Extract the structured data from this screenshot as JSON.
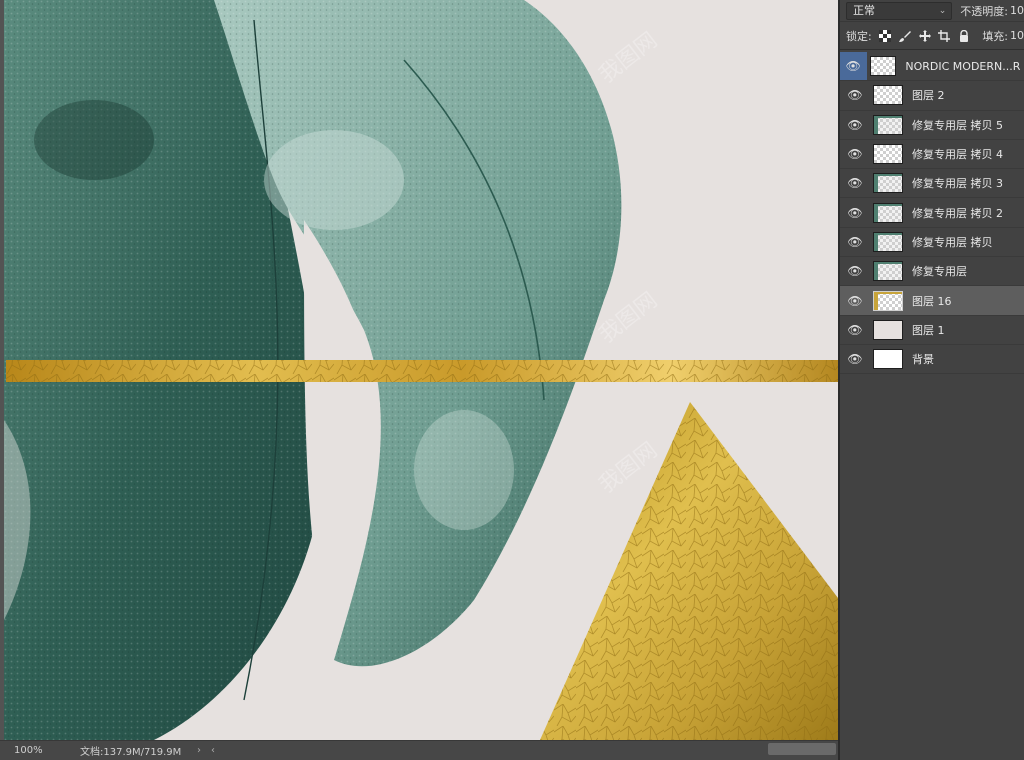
{
  "statusbar": {
    "zoom": "100%",
    "doc_info": "文档:137.9M/719.9M",
    "nav_right": "›",
    "nav_left": "‹"
  },
  "panel": {
    "blend_mode": "正常",
    "opacity_label": "不透明度:",
    "opacity_value": "10",
    "lock_label": "锁定:",
    "fill_label": "填充:",
    "fill_value": "10",
    "lock_icons": [
      "checkerboard-lock-icon",
      "brush-lock-icon",
      "move-lock-icon",
      "artboard-lock-icon",
      "padlock-icon"
    ]
  },
  "layers": [
    {
      "name": "NORDIC MODERN...R DE",
      "thumb": "checker",
      "visible": true
    },
    {
      "name": "图层 2",
      "thumb": "checker",
      "visible": true
    },
    {
      "name": "修复专用层 拷贝 5",
      "thumb": "leafy",
      "visible": true
    },
    {
      "name": "修复专用层 拷贝 4",
      "thumb": "checker",
      "visible": true
    },
    {
      "name": "修复专用层 拷贝 3",
      "thumb": "leafy",
      "visible": true
    },
    {
      "name": "修复专用层 拷贝 2",
      "thumb": "leafy",
      "visible": true
    },
    {
      "name": "修复专用层 拷贝",
      "thumb": "leafy",
      "visible": true
    },
    {
      "name": "修复专用层",
      "thumb": "leafy",
      "visible": true
    },
    {
      "name": "图层 16",
      "thumb": "gold",
      "visible": true,
      "selected": true
    },
    {
      "name": "图层 1",
      "thumb": "solid",
      "visible": true
    },
    {
      "name": "背景",
      "thumb": "white",
      "visible": true
    }
  ],
  "canvas": {
    "background_color": "#e6e1df",
    "leaf_color": "#3f7566",
    "gold_color": "#c9a43a"
  },
  "watermark": "我图网"
}
